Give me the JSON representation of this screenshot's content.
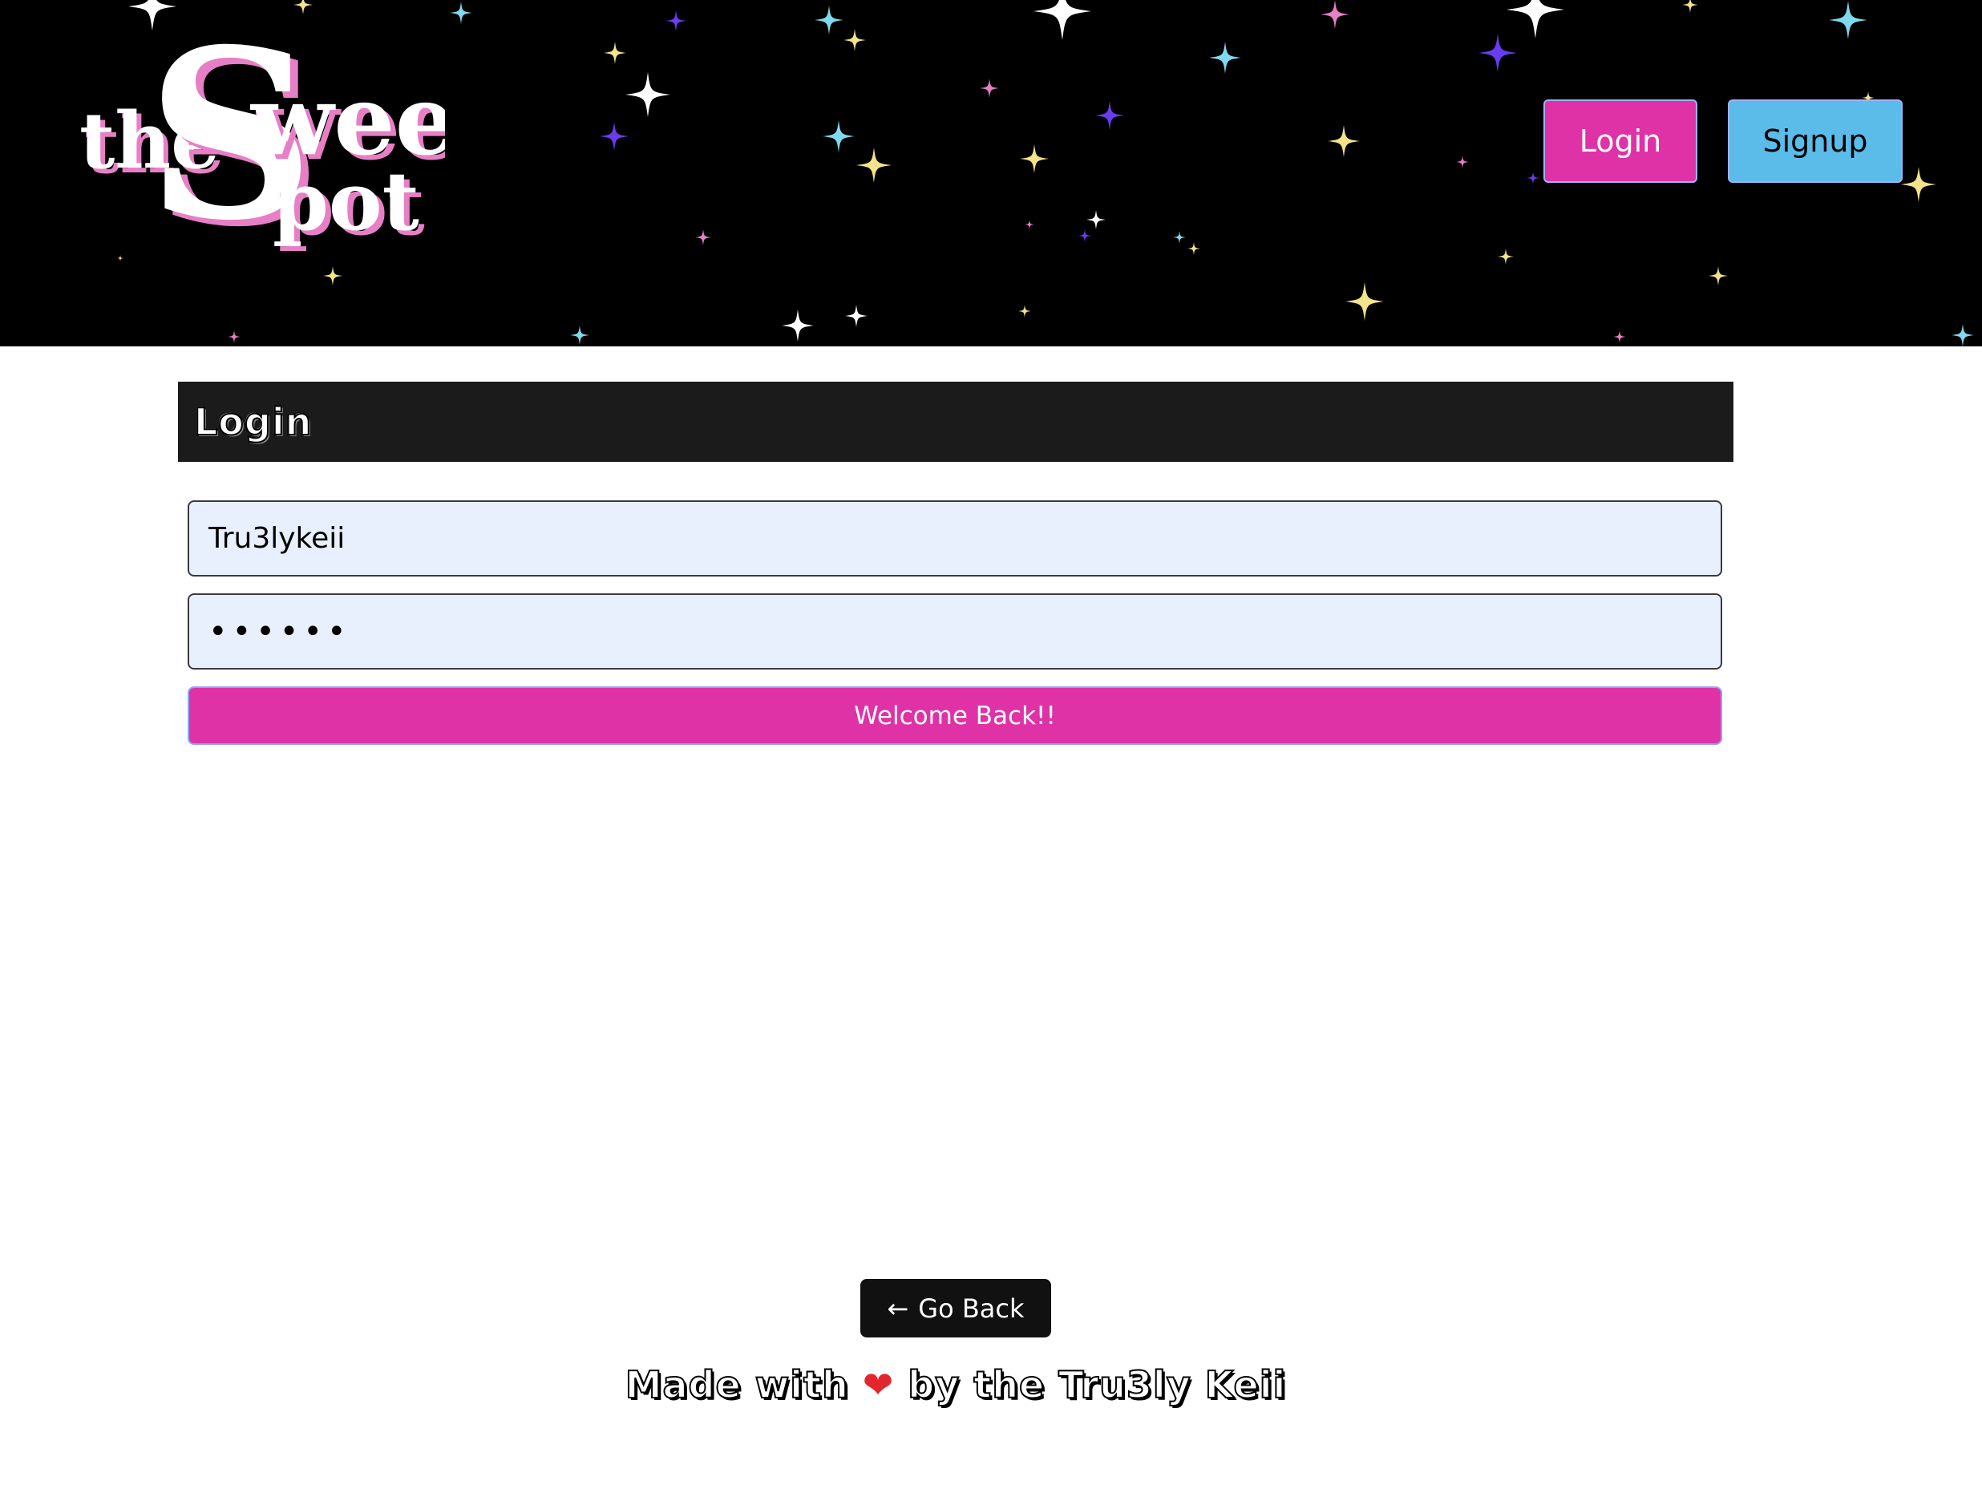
{
  "header": {
    "logo": {
      "text_the": "the",
      "text_sweet": "Sweet",
      "text_spot": "Spot",
      "text_pot": "pot"
    },
    "nav": {
      "login_label": "Login",
      "signup_label": "Signup"
    },
    "colors": {
      "background": "#000000",
      "login_button": "#df32a7",
      "signup_button": "#5bbbe9"
    }
  },
  "login_form": {
    "title": "Login",
    "username_value": "Tru3lykeii",
    "password_value": "••••••",
    "submit_label": "Welcome Back!!",
    "colors": {
      "field_background": "#e8f0fe",
      "submit_background": "#df32a7"
    }
  },
  "footer": {
    "go_back_label": "Go Back",
    "go_back_icon": "arrow-left-icon",
    "credit_prefix": "Made with",
    "credit_icon": "heart-icon",
    "credit_suffix": "by the Tru3ly Keii"
  }
}
